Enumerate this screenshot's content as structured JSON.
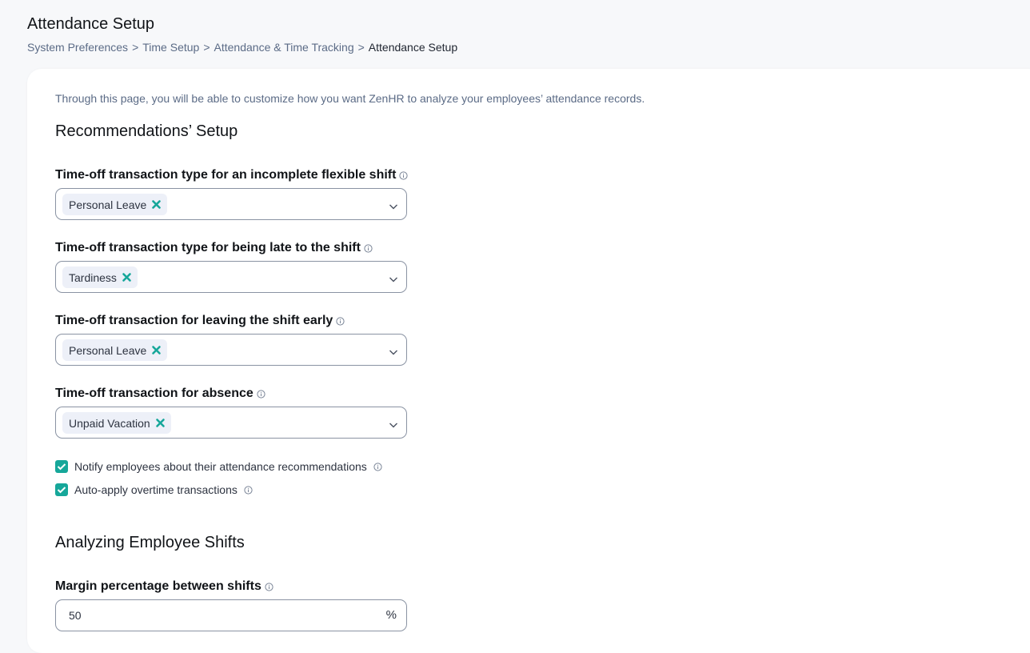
{
  "header": {
    "title": "Attendance Setup",
    "breadcrumb": [
      "System Preferences",
      "Time Setup",
      "Attendance & Time Tracking",
      "Attendance Setup"
    ],
    "separator": ">"
  },
  "intro": "Through this page, you will be able to customize how you want ZenHR to analyze your employees’ attendance records.",
  "recommendations": {
    "title": "Recommendations’ Setup",
    "fields": [
      {
        "label": "Time-off transaction type for an incomplete flexible shift",
        "selected": "Personal Leave"
      },
      {
        "label": "Time-off transaction type for being late to the shift",
        "selected": "Tardiness"
      },
      {
        "label": "Time-off transaction for leaving the shift early",
        "selected": "Personal Leave"
      },
      {
        "label": "Time-off transaction for absence",
        "selected": "Unpaid Vacation"
      }
    ],
    "checkboxes": [
      {
        "label": "Notify employees about their attendance recommendations",
        "checked": true
      },
      {
        "label": "Auto-apply overtime transactions",
        "checked": true
      }
    ]
  },
  "shifts": {
    "title": "Analyzing Employee Shifts",
    "margin_label": "Margin percentage between shifts",
    "margin_value": "50",
    "margin_suffix": "%"
  },
  "colors": {
    "accent": "#16a79a",
    "chip_bg": "#edf0f8",
    "muted_text": "#5b6b86"
  }
}
